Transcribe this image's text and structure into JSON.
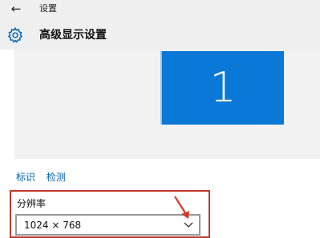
{
  "titlebar": {
    "back_icon": "back-arrow-icon",
    "title": "设置"
  },
  "header": {
    "icon": "gear-icon",
    "title": "高级显示设置"
  },
  "preview": {
    "monitor_number": "1",
    "monitor_color": "#0a78d7"
  },
  "links": {
    "identify": "标识",
    "detect": "检测",
    "color": "#0063b1"
  },
  "resolution": {
    "label": "分辨率",
    "value": "1024 × 768",
    "dropdown_icon": "chevron-down-icon"
  },
  "annotation": {
    "highlight_color": "#c0392b",
    "arrow_icon": "red-arrow-icon"
  }
}
